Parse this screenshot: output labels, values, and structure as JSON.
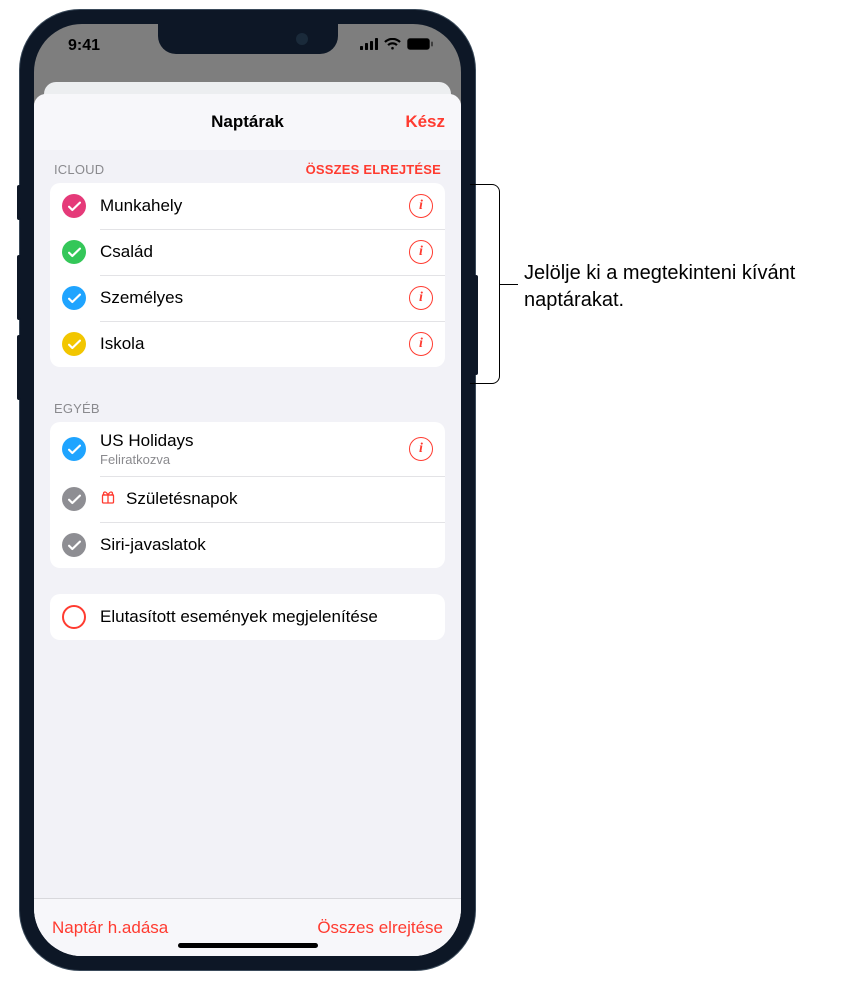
{
  "status": {
    "time": "9:41"
  },
  "header": {
    "title": "Naptárak",
    "done": "Kész"
  },
  "sections": {
    "icloud": {
      "label": "ICLOUD",
      "action": "ÖSSZES ELREJTÉSE",
      "items": [
        {
          "label": "Munkahely",
          "color": "#e53a79"
        },
        {
          "label": "Család",
          "color": "#34c759"
        },
        {
          "label": "Személyes",
          "color": "#1fa4ff"
        },
        {
          "label": "Iskola",
          "color": "#f2c600"
        }
      ]
    },
    "other": {
      "label": "EGYÉB",
      "items": [
        {
          "label": "US Holidays",
          "sub": "Feliratkozva",
          "color": "#1fa4ff",
          "info": true
        },
        {
          "label": "Születésnapok",
          "color": "#8e8e93",
          "gift": true
        },
        {
          "label": "Siri-javaslatok",
          "color": "#8e8e93"
        }
      ]
    },
    "declined": {
      "label": "Elutasított események megjelenítése"
    }
  },
  "footer": {
    "add": "Naptár h.adása",
    "hideAll": "Összes elrejtése"
  },
  "callout": {
    "text": "Jelölje ki a megtekinteni kívánt naptárakat."
  }
}
